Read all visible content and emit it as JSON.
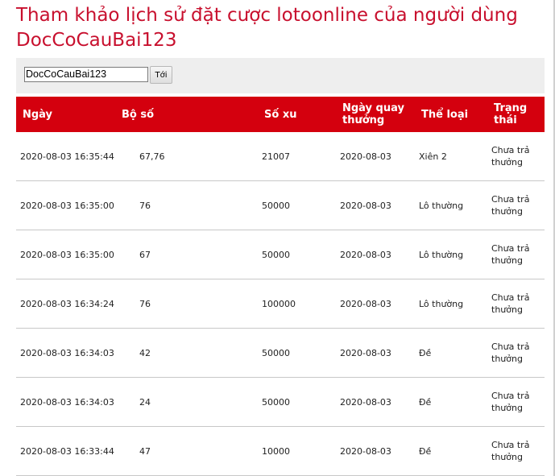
{
  "page": {
    "title": "Tham khảo lịch sử đặt cược lotoonline của người dùng DocCoCauBai123"
  },
  "search": {
    "value": "DocCoCauBai123",
    "button_label": "Tới"
  },
  "table": {
    "headers": [
      "Ngày",
      "Bộ số",
      "Số xu",
      "Ngày quay thưởng",
      "Thể loại",
      "Trạng thái"
    ],
    "rows": [
      {
        "date": "2020-08-03 16:35:44",
        "numbers": "67,76",
        "coins": "21007",
        "draw_date": "2020-08-03",
        "type": "Xiên 2",
        "status": "Chưa trả thưởng"
      },
      {
        "date": "2020-08-03 16:35:00",
        "numbers": "76",
        "coins": "50000",
        "draw_date": "2020-08-03",
        "type": "Lô thường",
        "status": "Chưa trả thưởng"
      },
      {
        "date": "2020-08-03 16:35:00",
        "numbers": "67",
        "coins": "50000",
        "draw_date": "2020-08-03",
        "type": "Lô thường",
        "status": "Chưa trả thưởng"
      },
      {
        "date": "2020-08-03 16:34:24",
        "numbers": "76",
        "coins": "100000",
        "draw_date": "2020-08-03",
        "type": "Lô thường",
        "status": "Chưa trả thưởng"
      },
      {
        "date": "2020-08-03 16:34:03",
        "numbers": "42",
        "coins": "50000",
        "draw_date": "2020-08-03",
        "type": "Đề",
        "status": "Chưa trả thưởng"
      },
      {
        "date": "2020-08-03 16:34:03",
        "numbers": "24",
        "coins": "50000",
        "draw_date": "2020-08-03",
        "type": "Đề",
        "status": "Chưa trả thưởng"
      },
      {
        "date": "2020-08-03 16:33:44",
        "numbers": "47",
        "coins": "10000",
        "draw_date": "2020-08-03",
        "type": "Đề",
        "status": "Chưa trả thưởng"
      }
    ]
  },
  "colors": {
    "title": "#c8102e",
    "header_bg": "#d4000e",
    "header_text": "#ffffff",
    "searchbar_bg": "#eeeeee"
  }
}
